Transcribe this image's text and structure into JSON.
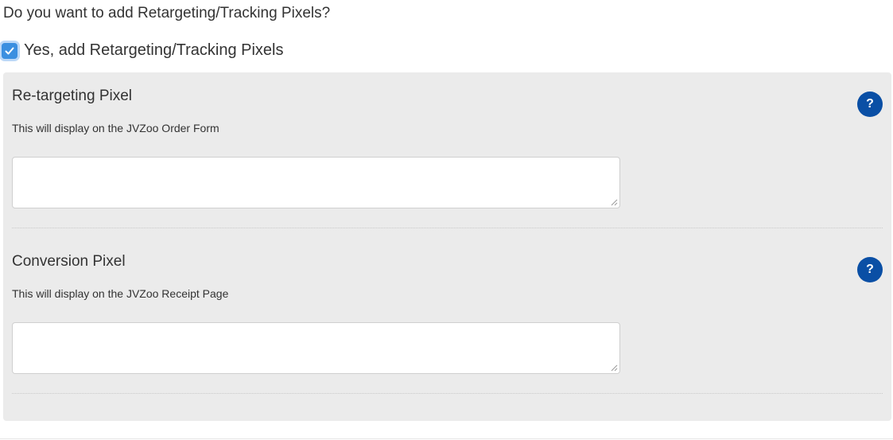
{
  "question": "Do you want to add Retargeting/Tracking Pixels?",
  "checkbox": {
    "label": "Yes, add Retargeting/Tracking Pixels",
    "checked": true,
    "color": "#3b8fe0"
  },
  "sections": [
    {
      "title": "Re-targeting Pixel",
      "subtitle": "This will display on the JVZoo Order Form",
      "help_symbol": "?",
      "textarea_value": "",
      "help_icon": "question-circle-icon"
    },
    {
      "title": "Conversion Pixel",
      "subtitle": "This will display on the JVZoo Receipt Page",
      "help_symbol": "?",
      "textarea_value": "",
      "help_icon": "question-circle-icon"
    }
  ],
  "colors": {
    "panel_bg": "#ebebeb",
    "help_icon_bg": "#0a4fa5"
  }
}
